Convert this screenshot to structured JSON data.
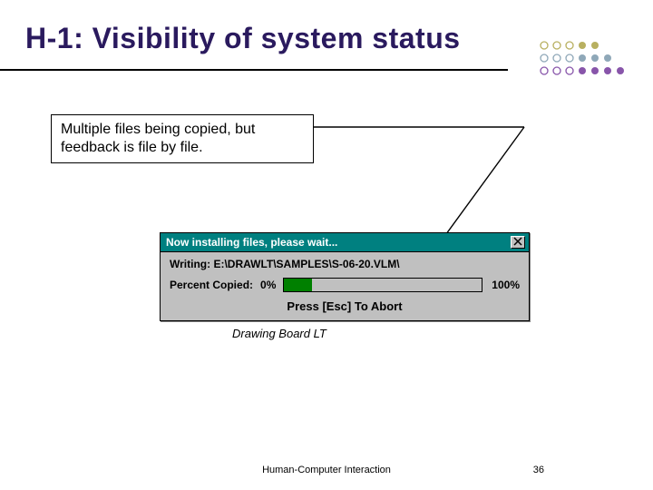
{
  "title": "H-1: Visibility of system status",
  "callout": "Multiple files being copied, but feedback is file by file.",
  "dialog": {
    "title": "Now installing files, please wait...",
    "writing_label": "Writing:",
    "writing_path": "E:\\DRAWLT\\SAMPLES\\S-06-20.VLM\\",
    "percent_label": "Percent Copied:",
    "percent_start": "0%",
    "percent_end": "100%",
    "progress_percent": 14,
    "abort": "Press [Esc] To Abort"
  },
  "caption": "Drawing Board LT",
  "footer": "Human-Computer Interaction",
  "page": "36"
}
